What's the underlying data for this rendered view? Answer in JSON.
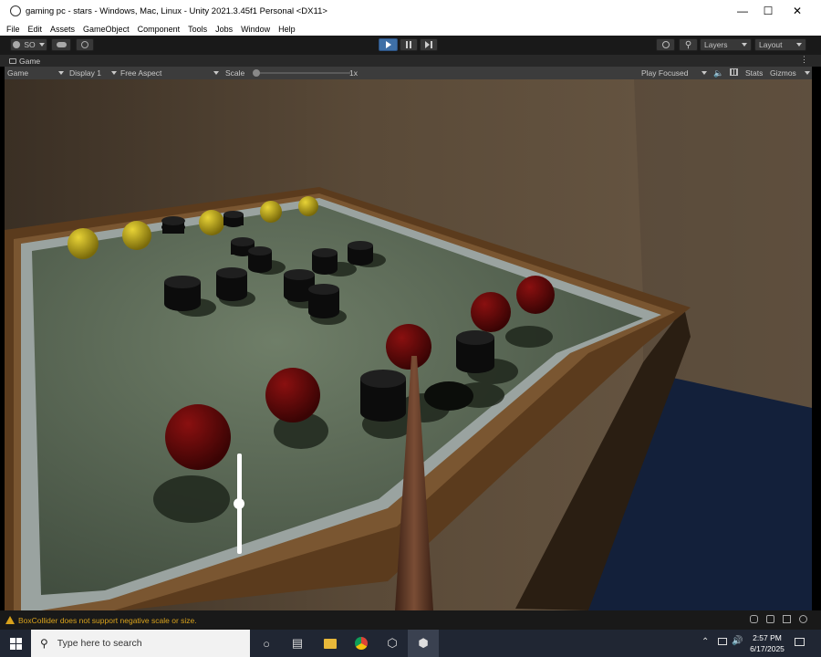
{
  "window": {
    "title": "gaming pc - stars - Windows, Mac, Linux - Unity 2021.3.45f1 Personal <DX11>"
  },
  "menu": [
    "File",
    "Edit",
    "Assets",
    "GameObject",
    "Component",
    "Tools",
    "Jobs",
    "Window",
    "Help"
  ],
  "toolbar": {
    "account_label": "SO",
    "layers_label": "Layers",
    "layout_label": "Layout"
  },
  "tab": {
    "label": "Game"
  },
  "gamebar": {
    "mode": "Game",
    "display": "Display 1",
    "aspect": "Free Aspect",
    "scale_label": "Scale",
    "scale_value": "1x",
    "play_focused": "Play Focused",
    "stats": "Stats",
    "gizmos": "Gizmos"
  },
  "status": {
    "warning": "BoxCollider does not support negative scale or size."
  },
  "taskbar": {
    "search_placeholder": "Type here to search",
    "time": "2:57 PM",
    "date": "6/17/2025"
  },
  "game": {
    "power_level": 0.5
  }
}
